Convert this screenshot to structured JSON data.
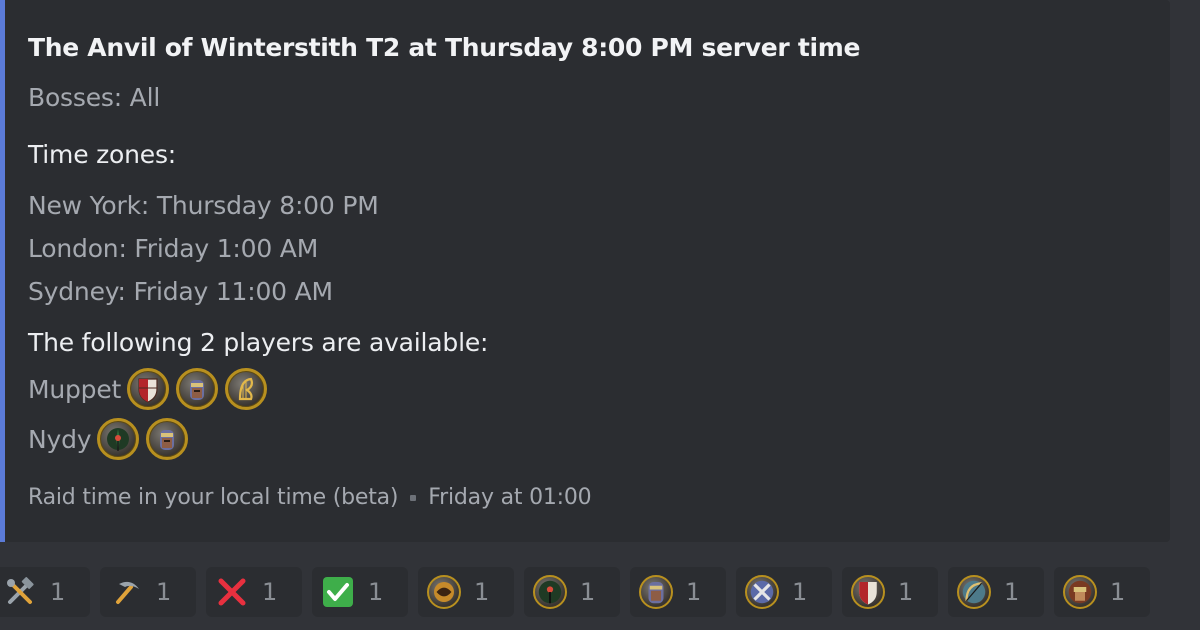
{
  "embed": {
    "title": "The Anvil of Winterstith T2 at Thursday 8:00 PM server time",
    "bosses": "Bosses: All",
    "timezones_heading": "Time zones:",
    "timezones": [
      "New York: Thursday 8:00 PM",
      "London: Friday 1:00 AM",
      "Sydney: Friday 11:00 AM"
    ],
    "players_heading": "The following 2 players are available:",
    "players": [
      {
        "name": "Muppet",
        "icons": [
          "captain-shield-icon",
          "guardian-helm-icon",
          "minstrel-harp-icon"
        ]
      },
      {
        "name": "Nydy",
        "icons": [
          "rune-keeper-icon",
          "guardian-helm-icon"
        ]
      }
    ],
    "footer_text": "Raid time in your local time (beta)",
    "footer_time": "Friday at 01:00"
  },
  "reactions": [
    {
      "icon": "hammer-wrench-icon",
      "count": "1"
    },
    {
      "icon": "pick-icon",
      "count": "1"
    },
    {
      "icon": "cross-mark-icon",
      "count": "1"
    },
    {
      "icon": "check-mark-icon",
      "count": "1"
    },
    {
      "icon": "burglar-class-icon",
      "count": "1"
    },
    {
      "icon": "rune-keeper-class-icon",
      "count": "1"
    },
    {
      "icon": "guardian-class-icon",
      "count": "1"
    },
    {
      "icon": "champion-class-icon",
      "count": "1"
    },
    {
      "icon": "captain-class-icon",
      "count": "1"
    },
    {
      "icon": "hunter-class-icon",
      "count": "1"
    },
    {
      "icon": "warden-class-icon",
      "count": "1"
    }
  ],
  "colors": {
    "background": "#313338",
    "embed_background": "#2b2d31",
    "embed_accent": "#5b7bd8",
    "icon_border_gold": "#b8901f"
  }
}
